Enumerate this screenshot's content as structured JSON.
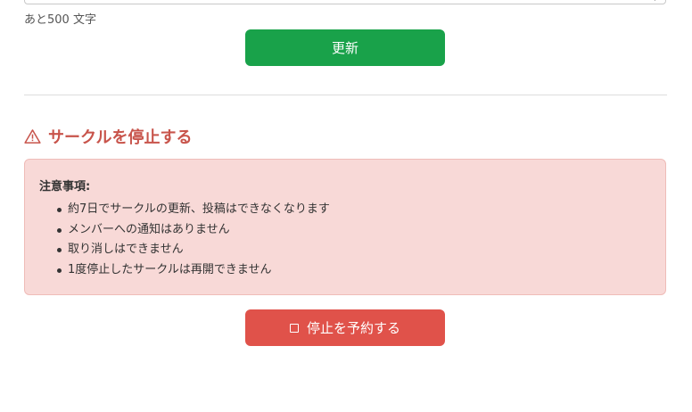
{
  "edit_form": {
    "char_count_label": "あと500 文字",
    "update_button_label": "更新"
  },
  "stop_section": {
    "title": "サークルを停止する",
    "notice_heading": "注意事項:",
    "notice_items": [
      "約7日でサークルの更新、投稿はできなくなります",
      "メンバーへの通知はありません",
      "取り消しはできません",
      "1度停止したサークルは再開できません"
    ],
    "schedule_stop_button_label": "停止を予約する"
  },
  "colors": {
    "update_button": "#19a24a",
    "stop_button": "#e0524a",
    "warning_text": "#c8544b",
    "notice_background": "#f8d9d7"
  },
  "icons": {
    "section_icon": "warning-triangle-icon",
    "button_icon": "checkbox-icon"
  }
}
